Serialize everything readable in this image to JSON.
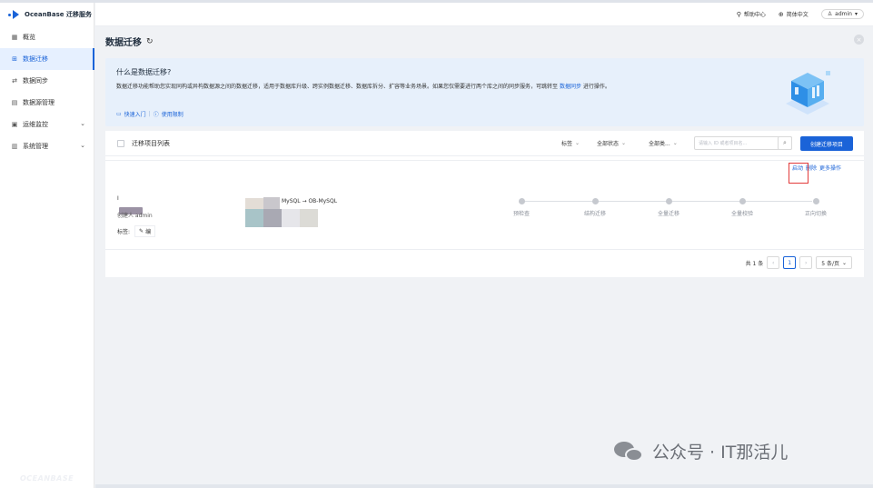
{
  "brand": {
    "name": "OceanBase 迁移服务",
    "footer_watermark": "OCEANBASE"
  },
  "sidebar": {
    "items": [
      {
        "label": "概览",
        "icon": "grid-icon",
        "active": false,
        "expandable": false
      },
      {
        "label": "数据迁移",
        "icon": "migration-icon",
        "active": true,
        "expandable": false
      },
      {
        "label": "数据同步",
        "icon": "sync-icon",
        "active": false,
        "expandable": false
      },
      {
        "label": "数据源管理",
        "icon": "datasource-icon",
        "active": false,
        "expandable": false
      },
      {
        "label": "运维监控",
        "icon": "monitor-icon",
        "active": false,
        "expandable": true
      },
      {
        "label": "系统管理",
        "icon": "system-icon",
        "active": false,
        "expandable": true
      }
    ]
  },
  "header": {
    "help": "帮助中心",
    "language": "简体中文",
    "user": "admin"
  },
  "page": {
    "title": "数据迁移"
  },
  "banner": {
    "title": "什么是数据迁移?",
    "description": "数据迁移功能帮助您实现同构或异构数据源之间的数据迁移，适用于数据库升级、跨实例数据迁移、数据库拆分、扩容等业务场景。如果您仅需要进行两个库之间的同步服务，可跳转至",
    "link_text": "数据同步",
    "description_suffix": "进行操作。",
    "quick_start": "快速入门",
    "limits": "使用限制",
    "separator": "|"
  },
  "list": {
    "title": "迁移项目列表",
    "filters": {
      "tag": "标签",
      "status": "全部状态",
      "type": "全部类..."
    },
    "search_placeholder": "请输入 ID 或者项目名...",
    "create_button": "创建迁移项目",
    "row_actions": {
      "start": "启动",
      "delete": "删除",
      "more": "更多操作"
    },
    "row": {
      "name_prefix": "I",
      "created_label": "创建人 admin",
      "tag_label": "标签:",
      "tag_value": "编",
      "type_text": "MySQL → OB-MySQL",
      "steps": [
        "预检查",
        "结构迁移",
        "全量迁移",
        "全量校验",
        "正向切换"
      ]
    },
    "pagination": {
      "total": "共 1 条",
      "current_page": "1",
      "page_size": "5 条/页"
    }
  },
  "watermark": {
    "text": "公众号 · IT那活儿"
  },
  "colors": {
    "primary": "#1a63d8",
    "banner_bg": "#e7f0fb",
    "highlight": "#e23b3b"
  }
}
